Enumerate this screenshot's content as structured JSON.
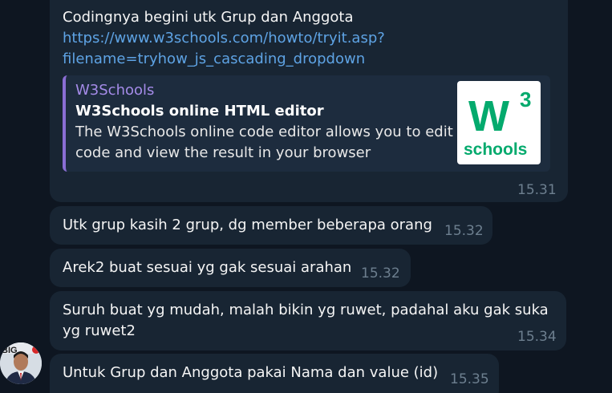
{
  "messages": [
    {
      "text": "Codingnya begini utk Grup dan Anggota",
      "link_line1": "https://www.w3schools.com/howto/tryit.asp?",
      "link_line2": "filename=tryhow_js_cascading_dropdown",
      "preview": {
        "site": "W3Schools",
        "title": "W3Schools online HTML editor",
        "description": "The W3Schools online code editor allows you to edit code and view the result in your browser",
        "thumb_logo_main": "W",
        "thumb_logo_sup": "3",
        "thumb_logo_sub": "schools"
      },
      "time": "15.31"
    },
    {
      "text": "Utk grup kasih 2 grup, dg member beberapa orang",
      "time": "15.32"
    },
    {
      "text": "Arek2 buat sesuai yg gak sesuai arahan",
      "time": "15.32"
    },
    {
      "text_line1": "Suruh buat yg mudah, malah bikin yg ruwet, padahal aku gak suka",
      "text_line2": "yg ruwet2",
      "time": "15.34"
    },
    {
      "text": "Untuk Grup dan Anggota pakai Nama dan value (id)",
      "time": "15.35"
    }
  ],
  "avatar_badge": "BIG",
  "colors": {
    "background": "#0e1621",
    "bubble": "#182533",
    "link": "#5ea3e4",
    "preview_accent": "#8a6ed4",
    "preview_site": "#a48be8",
    "time": "#6d7f8f",
    "w3_green": "#04aa6d"
  }
}
